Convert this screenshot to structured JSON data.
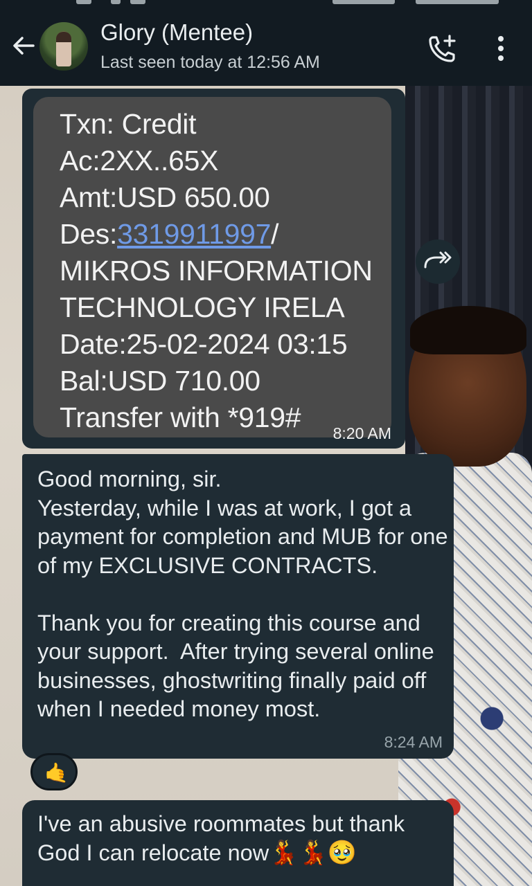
{
  "header": {
    "contact_name": "Glory (Mentee)",
    "last_seen": "Last seen today at 12:56 AM",
    "back_icon": "arrow-left-icon",
    "call_icon": "add-call-icon",
    "menu_icon": "more-vertical-icon"
  },
  "image_message": {
    "sms_lines": [
      "Txn: Credit",
      "Ac:2XX..65X",
      "Amt:USD 650.00",
      "MIKROS INFORMATION",
      "TECHNOLOGY IRELA",
      "Date:25-02-2024 03:15",
      "Bal:USD 710.00",
      "Transfer with *919#"
    ],
    "des_prefix": "Des:",
    "des_number": "3319911997",
    "des_suffix": "/",
    "time": "8:20 AM",
    "forward_icon": "forward-icon"
  },
  "text_message_1": {
    "text": "Good morning, sir.\nYesterday, while I was at work, I got a payment for completion and MUB for one of my EXCLUSIVE CONTRACTS.\n\nThank you for creating this course and your support.  After trying several online businesses, ghostwriting finally paid off when I needed money most.",
    "time": "8:24 AM",
    "reaction": "🤙"
  },
  "text_message_2": {
    "text": "I've an abusive roommates but thank God I can relocate now",
    "emojis": "💃💃🥹"
  },
  "colors": {
    "header_bg": "#121b22",
    "bubble_bg": "#1f2c34",
    "text": "#e9edef",
    "secondary_text": "#98a5ab",
    "link": "#6f9ae6"
  }
}
